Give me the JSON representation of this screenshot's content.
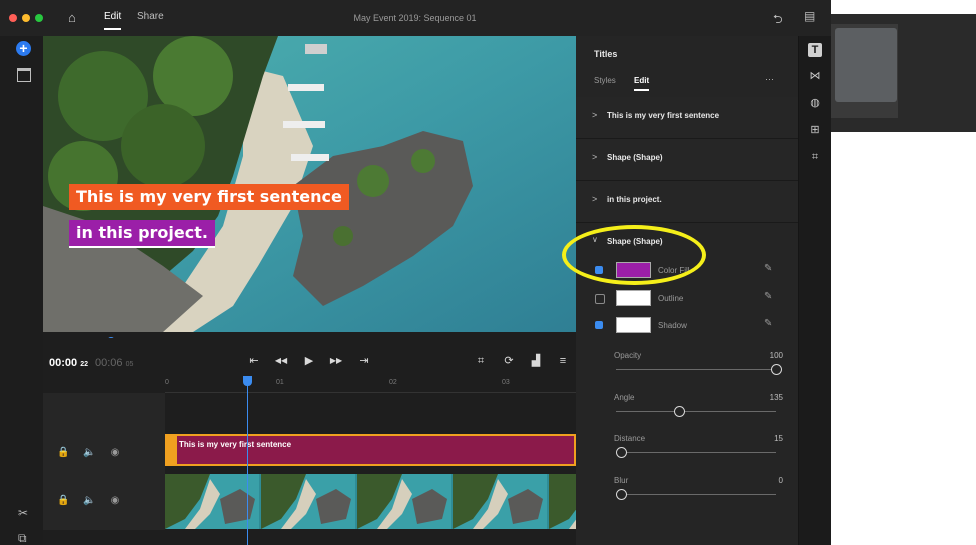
{
  "window": {
    "title": "May Event 2019: Sequence 01"
  },
  "topbar": {
    "tab_edit": "Edit",
    "tab_share": "Share"
  },
  "traffic_lights": {
    "close": "#ff5f57",
    "min": "#febc2e",
    "max": "#28c840"
  },
  "icons": {
    "home": "⌂",
    "undo": "⮌",
    "comments": "▤",
    "add": "+",
    "media": "▭",
    "prev_marker": "⇤",
    "step_back": "◀◀",
    "play": "▶",
    "step_fwd": "▶▶",
    "next_marker": "⇥",
    "fit": "⌗",
    "loop": "⟳",
    "volume": "▟",
    "menu": "≡",
    "lock": "🔒",
    "speaker": "🔈",
    "eye": "◉",
    "scissors": "✂",
    "stack": "⧉",
    "titles_rail": "T",
    "transitions": "⋈",
    "color": "◍",
    "transform": "⊞",
    "crop": "⌗",
    "eyedropper": "✎",
    "chevron_right": ">",
    "chevron_down": "∨"
  },
  "preview": {
    "line1": "This is my very first sentence",
    "line2": "in this project.",
    "line1_bg": "#f05a22",
    "line2_bg": "#9b1fa8"
  },
  "transport": {
    "current_time": "00:00",
    "current_frames": "22",
    "duration": "00:06",
    "duration_frames": "05"
  },
  "ruler": {
    "ticks": [
      "0",
      "01",
      "02",
      "03"
    ]
  },
  "timeline": {
    "title_clip_label": "This is my very first sentence",
    "title_clip_color": "#8b1a4a"
  },
  "panel": {
    "heading": "Titles",
    "tab_styles": "Styles",
    "tab_edit": "Edit",
    "more": "···",
    "sections": [
      {
        "label": "This is my very first sentence"
      },
      {
        "label": "Shape (Shape)"
      },
      {
        "label": "in this project."
      }
    ],
    "expanded_label": "Shape (Shape)",
    "props": {
      "fill_label": "Color Fill",
      "fill_color": "#9b1fa8",
      "outline_label": "Outline",
      "outline_color": "#ffffff",
      "shadow_label": "Shadow",
      "shadow_color": "#ffffff"
    },
    "sliders": [
      {
        "label": "Opacity",
        "value": "100",
        "fraction": 1.0
      },
      {
        "label": "Angle",
        "value": "135",
        "fraction": 0.375
      },
      {
        "label": "Distance",
        "value": "15",
        "fraction": 0.0
      },
      {
        "label": "Blur",
        "value": "0",
        "fraction": 0.0
      }
    ]
  },
  "annotation_color": "#f5ef1a"
}
